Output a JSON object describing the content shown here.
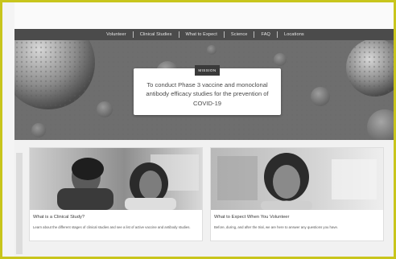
{
  "nav": {
    "items": [
      {
        "label": "Volunteer"
      },
      {
        "label": "Clinical Studies"
      },
      {
        "label": "What to Expect"
      },
      {
        "label": "Science"
      },
      {
        "label": "FAQ"
      },
      {
        "label": "Locations"
      }
    ]
  },
  "hero": {
    "badge": "MISSION",
    "mission_text": "To conduct Phase 3 vaccine and monoclonal antibody efficacy studies for the prevention of COVID-19"
  },
  "cards": [
    {
      "title": "What is a Clinical Study?",
      "description": "Learn about the different stages of clinical studies and see a list of active vaccine and antibody studies."
    },
    {
      "title": "What to Expect When You Volunteer",
      "description": "Before, during, and after the trial, we are here to answer any questions you have."
    }
  ],
  "colors": {
    "frame": "#c8c51c",
    "nav_bg": "#4b4b4b",
    "badge_bg": "#3a3a3a"
  }
}
